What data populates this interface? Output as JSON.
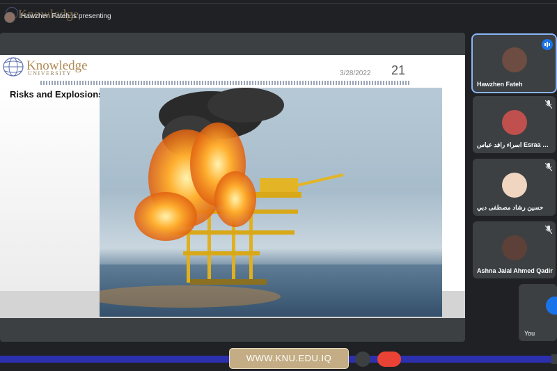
{
  "header": {
    "presenting_text": "Hawzhen Fateh is presenting",
    "watermark_text": "Knowledge"
  },
  "slide": {
    "logo_main": "Knowledge",
    "logo_sub": "UNIVERSITY",
    "date": "3/28/2022",
    "page_number": "21",
    "title": "Risks and Explosions"
  },
  "participants": [
    {
      "name": "Hawzhen Fateh",
      "state": "speaking",
      "avatar_color": "#6d4c41"
    },
    {
      "name": "اسراء رافد عباس Esraa Rafie...",
      "state": "muted",
      "avatar_color": "#c0504d"
    },
    {
      "name": "حسين رشاد مصطفى دبي",
      "state": "muted",
      "avatar_color": "#f0d5c0"
    },
    {
      "name": "Ashna Jalal Ahmed Qadir",
      "state": "muted",
      "avatar_color": "#5d4037"
    },
    {
      "name": "You",
      "state": "self",
      "avatar_color": "#1a73e8"
    }
  ],
  "banner": {
    "text": "WWW.KNU.EDU.IQ"
  },
  "colors": {
    "meet_bg": "#202124",
    "tile_bg": "#3c4043",
    "active_outline": "#8ab4f8",
    "banner_gold": "#c4ad84",
    "band_blue": "#2c2fae",
    "end_call_red": "#ea4335"
  },
  "icons": [
    "mic-off-icon",
    "speaking-indicator-icon",
    "globe-logo-icon"
  ]
}
